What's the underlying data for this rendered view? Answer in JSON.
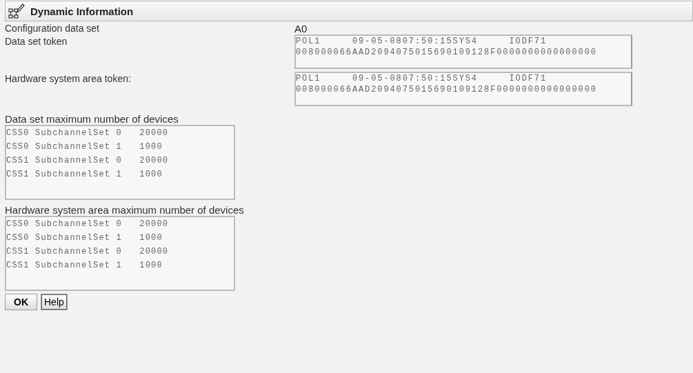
{
  "header": {
    "title": "Dynamic Information"
  },
  "fields": [
    {
      "kind": "value",
      "label": "Configuration data set",
      "value": "A0"
    },
    {
      "kind": "area",
      "label": "Data set token",
      "lines": [
        "POL1     09-05-0807:50:15SYS4     IODF71",
        "008000066AAD2094075015690109128F0000000000000000"
      ]
    },
    {
      "kind": "area",
      "label": "Hardware system area token:",
      "lines": [
        "POL1     09-05-0807:50:15SYS4     IODF71",
        "008000066AAD2094075015690109128F0000000000000000"
      ]
    }
  ],
  "lists": [
    {
      "label": "Data set maximum number of devices",
      "lines": [
        "CSS0 SubchannelSet 0   20000",
        "CSS0 SubchannelSet 1   1000",
        "CSS1 SubchannelSet 0   20000",
        "CSS1 SubchannelSet 1   1000"
      ]
    },
    {
      "label": "Hardware system area maximum number of devices",
      "lines": [
        "CSS0 SubchannelSet 0   20000",
        "CSS0 SubchannelSet 1   1000",
        "CSS1 SubchannelSet 0   20000",
        "CSS1 SubchannelSet 1   1000"
      ]
    }
  ],
  "buttons": [
    {
      "label": "OK",
      "kind": "primary"
    },
    {
      "label": "Help",
      "kind": "secondary"
    }
  ]
}
